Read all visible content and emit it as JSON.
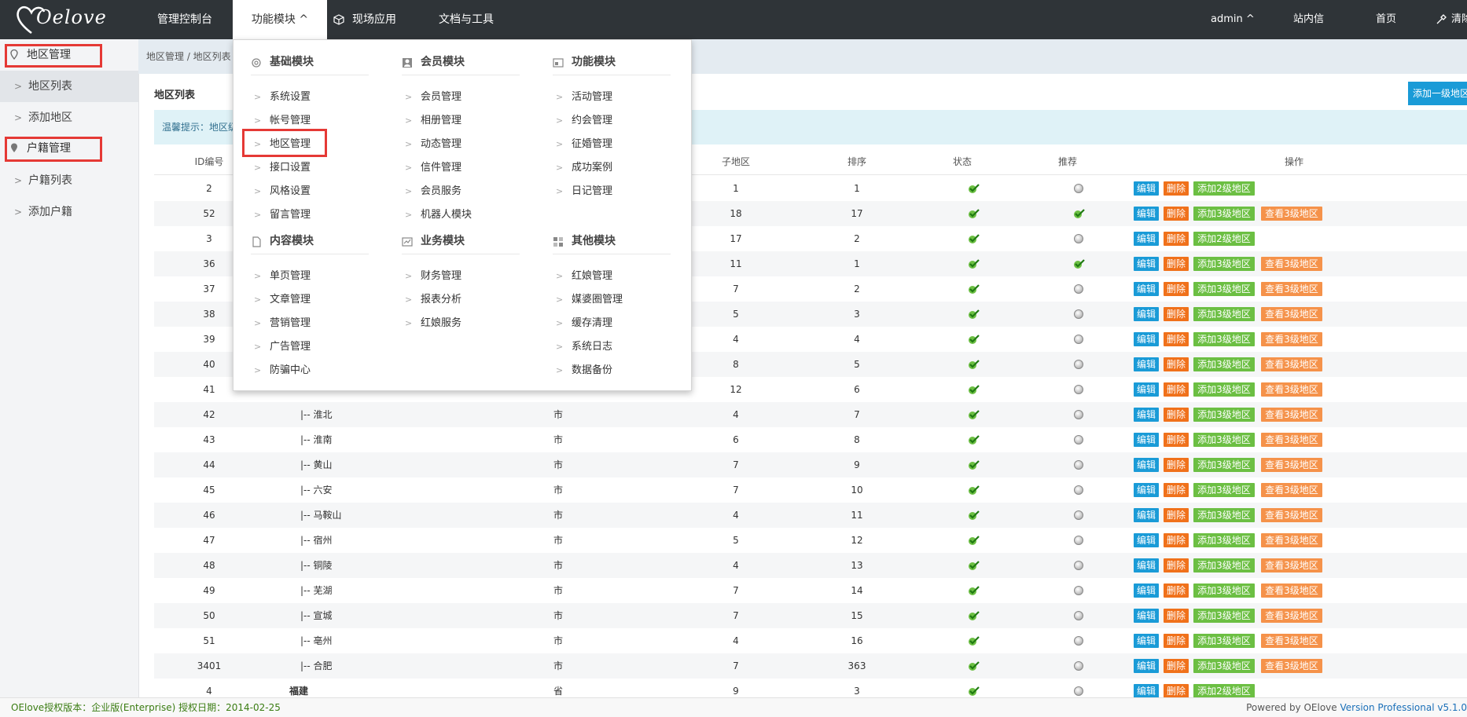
{
  "logo": {
    "text": "Oelove"
  },
  "nav": {
    "items": [
      "管理控制台",
      "功能模块 ^",
      "现场应用",
      "文档与工具"
    ],
    "right": [
      "admin ^",
      "站内信",
      "首页",
      "清除"
    ]
  },
  "sidebar": {
    "sections": [
      {
        "label": "地区管理",
        "items": [
          "地区列表",
          "添加地区"
        ]
      },
      {
        "label": "户籍管理",
        "items": [
          "户籍列表",
          "添加户籍"
        ]
      }
    ]
  },
  "breadcrumb": "地区管理 / 地区列表",
  "panel": {
    "title": "地区列表",
    "add_button": "添加一级地区",
    "tip": "温馨提示：地区级"
  },
  "table": {
    "headers": [
      "ID编号",
      "子地区",
      "排序",
      "状态",
      "推荐",
      "操作"
    ],
    "rows": [
      {
        "id": "2",
        "name": "",
        "level": "",
        "sub": "1",
        "sort": "1",
        "status": true,
        "rec": false,
        "add": "添加2级地区",
        "view": ""
      },
      {
        "id": "52",
        "name": "",
        "level": "",
        "sub": "18",
        "sort": "17",
        "status": true,
        "rec": true,
        "add": "添加3级地区",
        "view": "查看3级地区"
      },
      {
        "id": "3",
        "name": "",
        "level": "",
        "sub": "17",
        "sort": "2",
        "status": true,
        "rec": false,
        "add": "添加2级地区",
        "view": ""
      },
      {
        "id": "36",
        "name": "",
        "level": "",
        "sub": "11",
        "sort": "1",
        "status": true,
        "rec": true,
        "add": "添加3级地区",
        "view": "查看3级地区"
      },
      {
        "id": "37",
        "name": "",
        "level": "",
        "sub": "7",
        "sort": "2",
        "status": true,
        "rec": false,
        "add": "添加3级地区",
        "view": "查看3级地区"
      },
      {
        "id": "38",
        "name": "",
        "level": "",
        "sub": "5",
        "sort": "3",
        "status": true,
        "rec": false,
        "add": "添加3级地区",
        "view": "查看3级地区"
      },
      {
        "id": "39",
        "name": "",
        "level": "",
        "sub": "4",
        "sort": "4",
        "status": true,
        "rec": false,
        "add": "添加3级地区",
        "view": "查看3级地区"
      },
      {
        "id": "40",
        "name": "",
        "level": "",
        "sub": "8",
        "sort": "5",
        "status": true,
        "rec": false,
        "add": "添加3级地区",
        "view": "查看3级地区"
      },
      {
        "id": "41",
        "name": "",
        "level": "",
        "sub": "12",
        "sort": "6",
        "status": true,
        "rec": false,
        "add": "添加3级地区",
        "view": "查看3级地区"
      },
      {
        "id": "42",
        "name": "|-- 淮北",
        "level": "市",
        "sub": "4",
        "sort": "7",
        "status": true,
        "rec": false,
        "add": "添加3级地区",
        "view": "查看3级地区"
      },
      {
        "id": "43",
        "name": "|-- 淮南",
        "level": "市",
        "sub": "6",
        "sort": "8",
        "status": true,
        "rec": false,
        "add": "添加3级地区",
        "view": "查看3级地区"
      },
      {
        "id": "44",
        "name": "|-- 黄山",
        "level": "市",
        "sub": "7",
        "sort": "9",
        "status": true,
        "rec": false,
        "add": "添加3级地区",
        "view": "查看3级地区"
      },
      {
        "id": "45",
        "name": "|-- 六安",
        "level": "市",
        "sub": "7",
        "sort": "10",
        "status": true,
        "rec": false,
        "add": "添加3级地区",
        "view": "查看3级地区"
      },
      {
        "id": "46",
        "name": "|-- 马鞍山",
        "level": "市",
        "sub": "4",
        "sort": "11",
        "status": true,
        "rec": false,
        "add": "添加3级地区",
        "view": "查看3级地区"
      },
      {
        "id": "47",
        "name": "|-- 宿州",
        "level": "市",
        "sub": "5",
        "sort": "12",
        "status": true,
        "rec": false,
        "add": "添加3级地区",
        "view": "查看3级地区"
      },
      {
        "id": "48",
        "name": "|-- 铜陵",
        "level": "市",
        "sub": "4",
        "sort": "13",
        "status": true,
        "rec": false,
        "add": "添加3级地区",
        "view": "查看3级地区"
      },
      {
        "id": "49",
        "name": "|-- 芜湖",
        "level": "市",
        "sub": "7",
        "sort": "14",
        "status": true,
        "rec": false,
        "add": "添加3级地区",
        "view": "查看3级地区"
      },
      {
        "id": "50",
        "name": "|-- 宣城",
        "level": "市",
        "sub": "7",
        "sort": "15",
        "status": true,
        "rec": false,
        "add": "添加3级地区",
        "view": "查看3级地区"
      },
      {
        "id": "51",
        "name": "|-- 亳州",
        "level": "市",
        "sub": "4",
        "sort": "16",
        "status": true,
        "rec": false,
        "add": "添加3级地区",
        "view": "查看3级地区"
      },
      {
        "id": "3401",
        "name": "|-- 合肥",
        "level": "市",
        "sub": "7",
        "sort": "363",
        "status": true,
        "rec": false,
        "add": "添加3级地区",
        "view": "查看3级地区"
      },
      {
        "id": "4",
        "name": "福建",
        "level": "省",
        "sub": "9",
        "sort": "3",
        "status": true,
        "rec": false,
        "add": "添加2级地区",
        "view": ""
      }
    ],
    "edit_label": "编辑",
    "delete_label": "删除"
  },
  "mega_menu": {
    "columns": [
      {
        "groups": [
          {
            "title": "基础模块",
            "icon": "gear-icon",
            "items": [
              "系统设置",
              "帐号管理",
              "地区管理",
              "接口设置",
              "风格设置",
              "留言管理"
            ]
          },
          {
            "title": "内容模块",
            "icon": "document-icon",
            "items": [
              "单页管理",
              "文章管理",
              "营销管理",
              "广告管理",
              "防骗中心"
            ]
          }
        ]
      },
      {
        "groups": [
          {
            "title": "会员模块",
            "icon": "user-icon",
            "items": [
              "会员管理",
              "相册管理",
              "动态管理",
              "信件管理",
              "会员服务",
              "机器人模块"
            ]
          },
          {
            "title": "业务模块",
            "icon": "report-icon",
            "items": [
              "财务管理",
              "报表分析",
              "红娘服务"
            ]
          }
        ]
      },
      {
        "groups": [
          {
            "title": "功能模块",
            "icon": "module-icon",
            "items": [
              "活动管理",
              "约会管理",
              "征婚管理",
              "成功案例",
              "日记管理"
            ]
          },
          {
            "title": "其他模块",
            "icon": "grid-icon",
            "items": [
              "红娘管理",
              "媒婆圈管理",
              "缓存清理",
              "系统日志",
              "数据备份"
            ]
          }
        ]
      }
    ]
  },
  "footer": {
    "left": "OElove授权版本：企业版(Enterprise) 授权日期：2014-02-25",
    "right_prefix": "Powered by OElove ",
    "right_version": "Version Professional v5.1.0"
  },
  "colors": {
    "topbar": "#2f3438",
    "edit": "#1a9bd7",
    "delete": "#f0711b",
    "add": "#6cbf43",
    "view": "#f5924a",
    "highlight": "#e53935"
  }
}
